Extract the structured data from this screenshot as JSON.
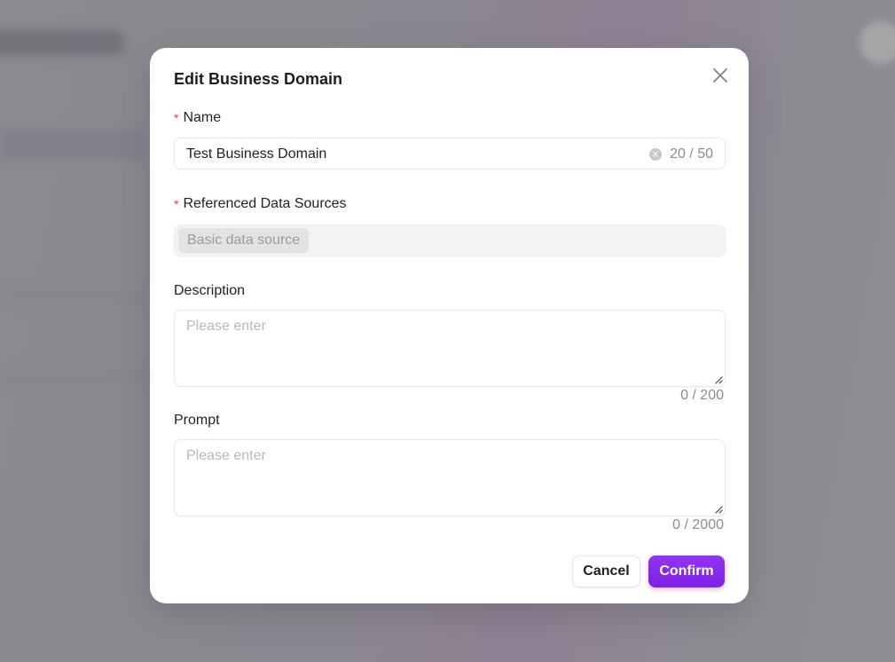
{
  "dialog": {
    "title": "Edit Business Domain",
    "close_icon": "close-icon"
  },
  "fields": {
    "name": {
      "label": "Name",
      "required_mark": "*",
      "value": "Test Business Domain",
      "counter": "20 / 50",
      "clear_icon": "clear-circle-icon"
    },
    "data_sources": {
      "label": "Referenced Data Sources",
      "required_mark": "*",
      "tags": [
        "Basic data source"
      ]
    },
    "description": {
      "label": "Description",
      "placeholder": "Please enter",
      "counter": "0 / 200"
    },
    "prompt": {
      "label": "Prompt",
      "placeholder": "Please enter",
      "counter": "0 / 2000"
    }
  },
  "actions": {
    "cancel_label": "Cancel",
    "confirm_label": "Confirm"
  },
  "colors": {
    "accent": "#8a2be2",
    "required": "#e2365f",
    "overlay": "#8e8a92"
  }
}
